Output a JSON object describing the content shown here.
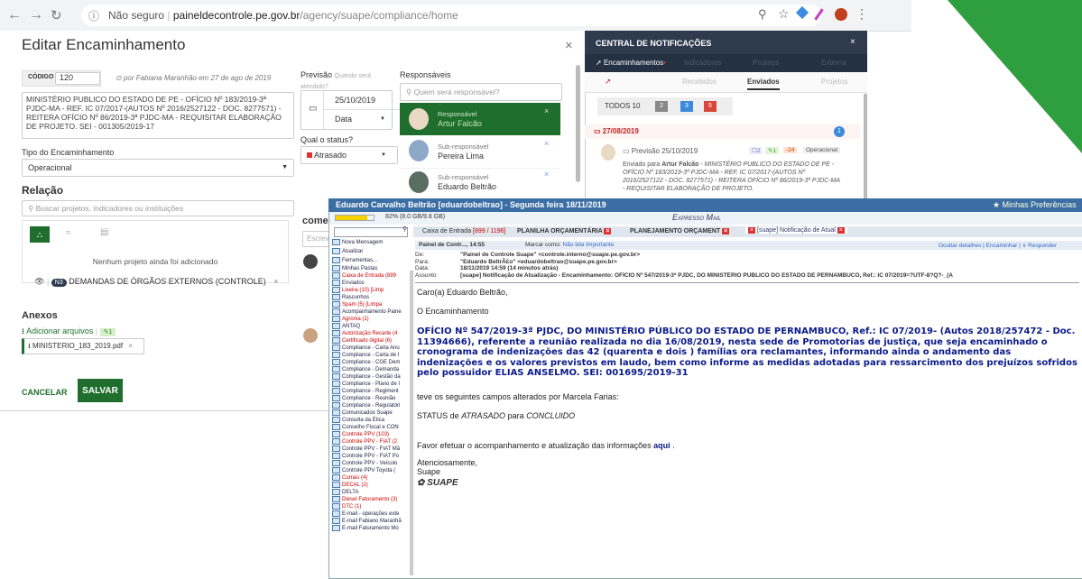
{
  "browser": {
    "url_secure": "Não seguro",
    "url_domain": "paineldecontrole.pe.gov.br",
    "url_path": "/agency/suape/compliance/home"
  },
  "editor": {
    "title": "Editar Encaminhamento",
    "code_label": "CÓDIGO",
    "code_value": "120",
    "author": "por Fabiana Maranhão em 27 de ago de 2019",
    "description": "MINISTÉRIO PUBLICO DO ESTADO DE PE - OFÍCIO Nº 183/2019-3ª PJDC-MA - REF. IC 07/2017-(AUTOS Nº 2016/2527122 - DOC. 8277571) - REITERA OFÍCIO Nº 86/2019-3ª PJDC-MA - REQUISITAR ELABORAÇÃO DE PROJETO. SEI - 001305/2019-17",
    "previsao_label": "Previsão",
    "previsao_hint": "Quando será atendido?",
    "previsao_date": "25/10/2019",
    "previsao_type": "Data",
    "status_label": "Qual o status?",
    "status_value": "Atrasado",
    "tipo_label": "Tipo do Encaminhamento",
    "tipo_value": "Operacional",
    "relacao_label": "Relação",
    "relacao_search": "Buscar projetos, indicadores ou instituições",
    "relacao_empty": "Nenhum projeto ainda foi adicionado",
    "relacao_tag_code": "N3",
    "relacao_tag": "DEMANDAS DE ÓRGÃOS EXTERNOS (CONTROLE)",
    "anexos_label": "Anexos",
    "anexos_add": "Adicionar arquivos",
    "anexos_count": "1",
    "anexos_file": "MINISTERIO_183_2019.pdf",
    "responsaveis_label": "Responsáveis",
    "responsaveis_search": "Quem será responsável?",
    "responsaveis": [
      {
        "role": "Responsável",
        "name": "Artur Falcão"
      },
      {
        "role": "Sub-responsável",
        "name": "Pereira Lima"
      },
      {
        "role": "Sub-responsável",
        "name": "Eduardo Beltrão"
      }
    ],
    "comments_label": "come",
    "comments_placeholder": "Escrev",
    "cancel": "CANCELAR",
    "save": "SALVAR"
  },
  "notifications": {
    "title": "CENTRAL DE NOTIFICAÇÕES",
    "tabs": [
      "Encaminhamentos",
      "Indicadores",
      "Projetos",
      "Externa"
    ],
    "subtabs": [
      "Recebidos",
      "Enviados",
      "Projetos"
    ],
    "todos_label": "TODOS 10",
    "counts": [
      "2",
      "3",
      "5"
    ],
    "date": "27/08/2019",
    "date_count": "1",
    "item_previsao": "Previsão 25/10/2019",
    "item_tag1": "2",
    "item_tag2": "1",
    "item_tag3": "24",
    "item_type": "Operacional",
    "item_text_prefix": "Enviado para",
    "item_text_name": "Artur Falcão",
    "item_text": "- MINISTÉRIO PUBLICO DO ESTADO DE PE - OFÍCIO Nº 183/2019-3ª PJDC-MA - REF. IC 07/2017-(AUTOS Nº 2016/2527122 - DOC. 8277571) - REITERA OFÍCIO Nº 86/2019-3ª PJDC-MA - REQUISITAR ELABORAÇÃO DE PROJETO."
  },
  "mail": {
    "window_title": "Eduardo Carvalho Beltrão [eduardobeltrao] - Segunda feira 18/11/2019",
    "prefs": "Minhas Preferências",
    "quota": "82% (8.0 GB/9.8 GB)",
    "app_title": "Expresso Mail",
    "inbox_tab": "Caixa de Entrada",
    "inbox_count": "[899 / 1196]",
    "tab2": "PLANILHA ORÇAMENTÁRIA",
    "tab3": "PLANEJAMENTO ORÇAMENT",
    "tab4": "[suape] Notificação de Atual",
    "msg_toolbar_left": "Painel de Contr..., 14:55",
    "msg_mark": "Marcar como:",
    "msg_unread": "Não lida",
    "msg_important": "Importante",
    "msg_actions": "Ocultar detalhes | Encaminhar | ∨ Responder",
    "hdr_de_label": "De:",
    "hdr_de": "\"Painel de Controle Suape\" <controle.interno@suape.pe.gov.br>",
    "hdr_para_label": "Para:",
    "hdr_para": "\"Eduardo BeltrÃ£o\" <eduardobeltrao@suape.pe.gov.br>",
    "hdr_data_label": "Data:",
    "hdr_data": "18/11/2019 14:59 (14 minutos atrás)",
    "hdr_assunto_label": "Assunto",
    "hdr_assunto": "[suape] Notificação de Atualização - Encaminhamento: OFÍCIO Nº 547/2019-3ª PJDC, DO MINISTÉRIO PÚBLICO DO ESTADO DE PERNAMBUCO, Ref.: IC 07/2019=?UTF-8?Q?-_(A",
    "greeting": "Caro(a) Eduardo Beltrão,",
    "intro": "O Encaminhamento",
    "body_bold": "OFÍCIO Nº 547/2019-3ª PJDC, DO MINISTÉRIO PÚBLICO DO ESTADO DE PERNAMBUCO, Ref.: IC 07/2019- (Autos 2018/257472 - Doc. 11394666), referente a reunião realizada no dia 16/08/2019, nesta sede de Promotorias de justiça, que seja encaminhado o cronograma de indenizações das 42 (quarenta e dois ) famílias ora reclamantes, informando ainda o andamento das indenizações e os valores previstos em laudo, bem como informe as medidas adotadas para ressarcimento dos prejuízos sofridos pelo possuidor ELIAS ANSELMO. SEI: 001695/2019-31",
    "changed": "teve os seguintes campos alterados por Marcela Farias:",
    "status_prefix": "STATUS de",
    "status_from": "ATRASADO",
    "status_mid": "para",
    "status_to": "CONCLUIDO",
    "followup": "Favor efetuar o acompanhamento e atualização das informações",
    "followup_link": "aqui",
    "regards": "Atenciosamente,",
    "sign": "Suape",
    "logo": "SUAPE",
    "sidebar_actions": [
      "Nova Mensagem",
      "Atualizar",
      "Ferramentas..."
    ],
    "folders": [
      "Minhas Pastas",
      "Caixa de Entrada (899",
      "Enviados",
      "Lixeira (10)   [Limp",
      "Rascunhos",
      "Spam (5)   [Limpa",
      "Acompanhamento Paine",
      "Agronia (1)",
      "ANTAQ",
      "Autorização Recarte (4",
      "Certificado digital (6)",
      "Compliance - Carta Anu",
      "Compliance - Carta de I",
      "Compliance - CGE Dem",
      "Compliance - Demanda",
      "Compliance - Gestão da",
      "Compliance - Plano de I",
      "Compliance - Regiment",
      "Compliance - Reunião",
      "Compliance - Regulatóri",
      "Comunicados Suape",
      "Consulta da Ética",
      "Conselho Fiscal e CON",
      "Controle PPV (103)",
      "Controle PPV - FIAT (2",
      "Controle PPV - FIAT Mã",
      "Controle PPV - FIAT Po",
      "Controle PPV - Veículo",
      "Controle PPV Toyota (",
      "Currais (4)",
      "DECAL (2)",
      "DELTA",
      "Diesel Faturamento (3)",
      "DTC (1)",
      "E-mail - operações exte",
      "E-mail Fabiano Maranhã",
      "E-mail Faturamento Mo"
    ]
  }
}
